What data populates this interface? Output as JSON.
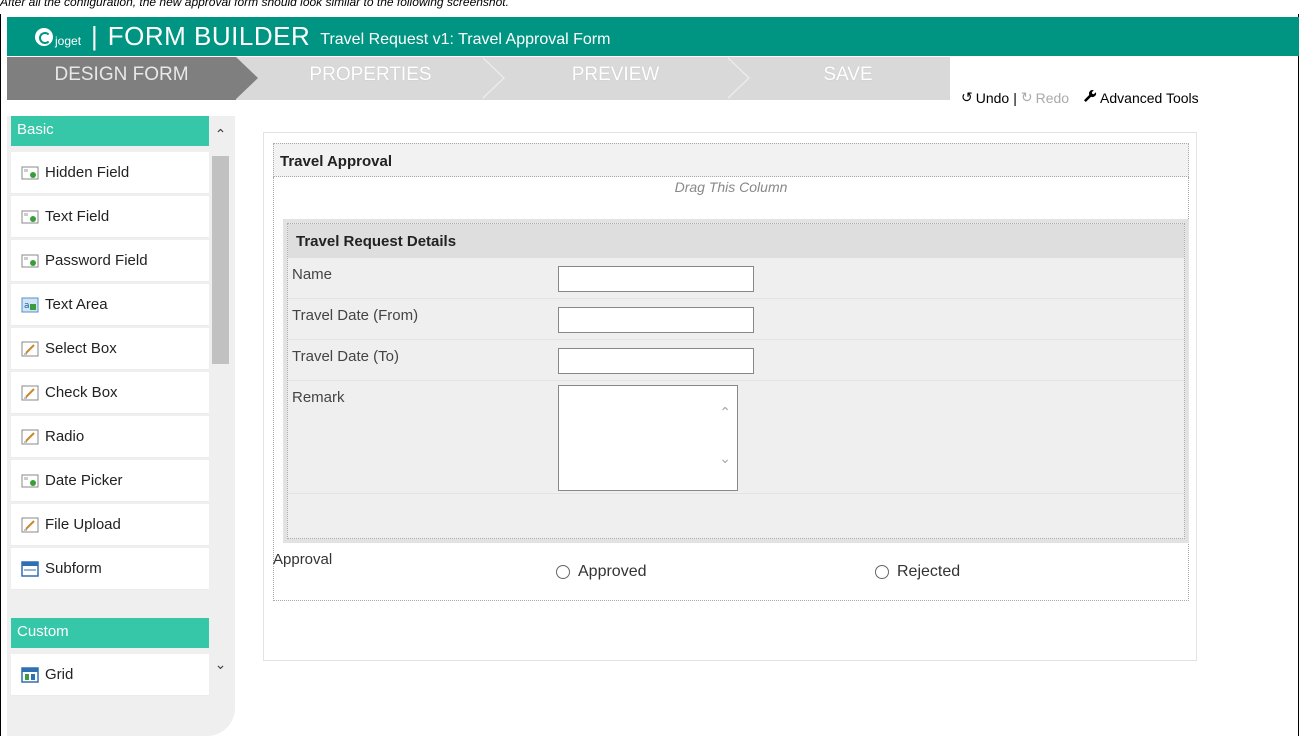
{
  "caption": "After all the configuration, the new approval form should look similar to the following screenshot.",
  "header": {
    "logo_text": "joget",
    "separator": "|",
    "app_title": "FORM BUILDER",
    "form_title": "Travel Request v1: Travel Approval Form"
  },
  "wizard": {
    "steps": [
      {
        "label": "DESIGN FORM",
        "active": true
      },
      {
        "label": "PROPERTIES",
        "active": false
      },
      {
        "label": "PREVIEW",
        "active": false
      },
      {
        "label": "SAVE",
        "active": false
      }
    ]
  },
  "toolbar": {
    "undo_label": "Undo",
    "divider": "|",
    "redo_label": "Redo",
    "advanced_label": "Advanced Tools"
  },
  "palette": {
    "basic_header": "Basic",
    "basic_items": [
      {
        "label": "Hidden Field",
        "icon": "hidden-field-icon"
      },
      {
        "label": "Text Field",
        "icon": "text-field-icon"
      },
      {
        "label": "Password Field",
        "icon": "password-field-icon"
      },
      {
        "label": "Text Area",
        "icon": "text-area-icon"
      },
      {
        "label": "Select Box",
        "icon": "select-box-icon"
      },
      {
        "label": "Check Box",
        "icon": "check-box-icon"
      },
      {
        "label": "Radio",
        "icon": "radio-icon"
      },
      {
        "label": "Date Picker",
        "icon": "date-picker-icon"
      },
      {
        "label": "File Upload",
        "icon": "file-upload-icon"
      },
      {
        "label": "Subform",
        "icon": "subform-icon"
      }
    ],
    "custom_header": "Custom",
    "custom_items": [
      {
        "label": "Grid",
        "icon": "grid-icon"
      }
    ]
  },
  "form": {
    "section_title": "Travel Approval",
    "drag_hint": "Drag This Column",
    "subsection_title": "Travel Request Details",
    "fields": [
      {
        "label": "Name",
        "value": ""
      },
      {
        "label": "Travel Date (From)",
        "value": ""
      },
      {
        "label": "Travel Date (To)",
        "value": ""
      },
      {
        "label": "Remark",
        "value": ""
      }
    ],
    "approval": {
      "label": "Approval",
      "options": [
        "Approved",
        "Rejected"
      ]
    }
  },
  "colors": {
    "header_bg": "#009482",
    "palette_header": "#35c7a8",
    "active_step": "#7f7f7f"
  }
}
